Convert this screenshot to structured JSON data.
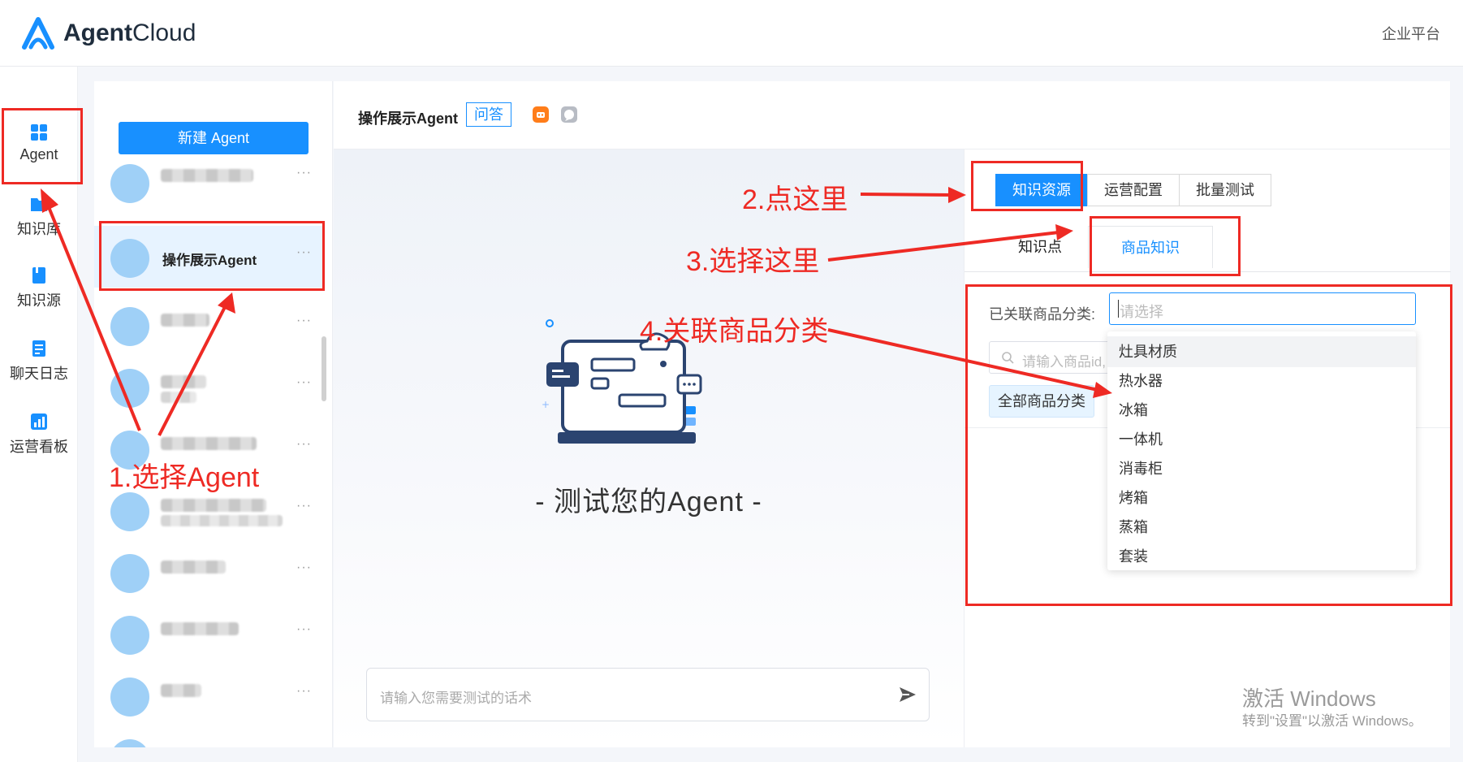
{
  "header": {
    "brand_bold": "Agent",
    "brand_light": "Cloud",
    "right_link": "企业平台"
  },
  "nav": {
    "items": [
      {
        "label": "Agent",
        "icon": "grid-icon"
      },
      {
        "label": "知识库",
        "icon": "folder-icon"
      },
      {
        "label": "知识源",
        "icon": "book-icon"
      },
      {
        "label": "聊天日志",
        "icon": "log-icon"
      },
      {
        "label": "运营看板",
        "icon": "chart-icon"
      }
    ]
  },
  "agents": {
    "new_button": "新建 Agent",
    "selected_name": "操作展示Agent",
    "more": "···"
  },
  "chat": {
    "title": "操作展示Agent",
    "mode_tag": "问答",
    "caption": "- 测试您的Agent -",
    "input_placeholder": "请输入您需要测试的话术"
  },
  "config": {
    "tabs": [
      "知识资源",
      "运营配置",
      "批量测试"
    ],
    "active_tab": "知识资源",
    "subtabs": [
      "知识点",
      "商品知识"
    ],
    "active_subtab": "商品知识",
    "linked_label": "已关联商品分类:",
    "select_placeholder": "请选择",
    "search_placeholder": "请输入商品id,",
    "all_categories": "全部商品分类",
    "dropdown_options": [
      "灶具材质",
      "热水器",
      "冰箱",
      "一体机",
      "消毒柜",
      "烤箱",
      "蒸箱",
      "套装"
    ]
  },
  "annotations": {
    "step1": "1.选择Agent",
    "step2": "2.点这里",
    "step3": "3.选择这里",
    "step4": "4.关联商品分类"
  },
  "watermark": {
    "line1": "激活 Windows",
    "line2": "转到\"设置\"以激活 Windows。"
  },
  "colors": {
    "primary": "#1890ff",
    "annotation_red": "#ee2a24",
    "avatar_blue": "#9fd0f7"
  }
}
